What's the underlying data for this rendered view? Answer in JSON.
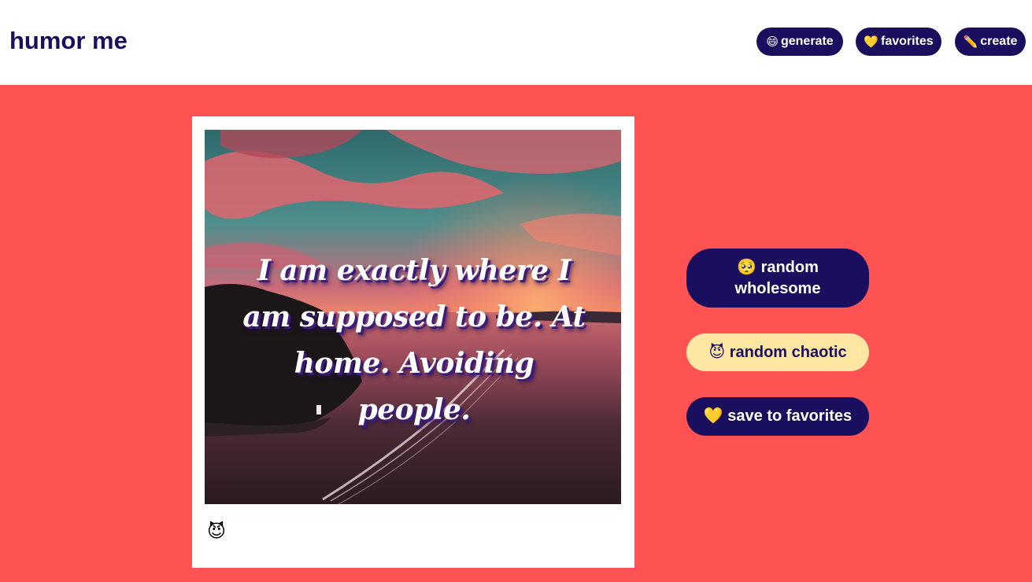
{
  "header": {
    "brand": "humor me",
    "nav": [
      {
        "icon": "grinning-face-icon",
        "glyph": "😄",
        "label": "generate"
      },
      {
        "icon": "yellow-heart-icon",
        "glyph": "💛",
        "label": "favorites"
      },
      {
        "icon": "pencil-icon",
        "glyph": "✏️",
        "label": "create"
      }
    ]
  },
  "card": {
    "quote": "I am exactly where I am supposed to be. At home. Avoiding people.",
    "category_icon": "smiling-devil-icon",
    "category_glyph": "😈"
  },
  "actions": {
    "wholesome": {
      "icon": "pleading-face-icon",
      "glyph": "🥺",
      "label": "random wholesome"
    },
    "chaotic": {
      "icon": "smiling-devil-icon",
      "glyph": "😈",
      "label": "random chaotic"
    },
    "save": {
      "icon": "yellow-heart-icon",
      "glyph": "💛",
      "label": "save to favorites"
    }
  },
  "colors": {
    "background": "#ff5252",
    "brand": "#1a0f5e",
    "chaotic_button": "#ffe6a3",
    "header": "#ffffff"
  }
}
